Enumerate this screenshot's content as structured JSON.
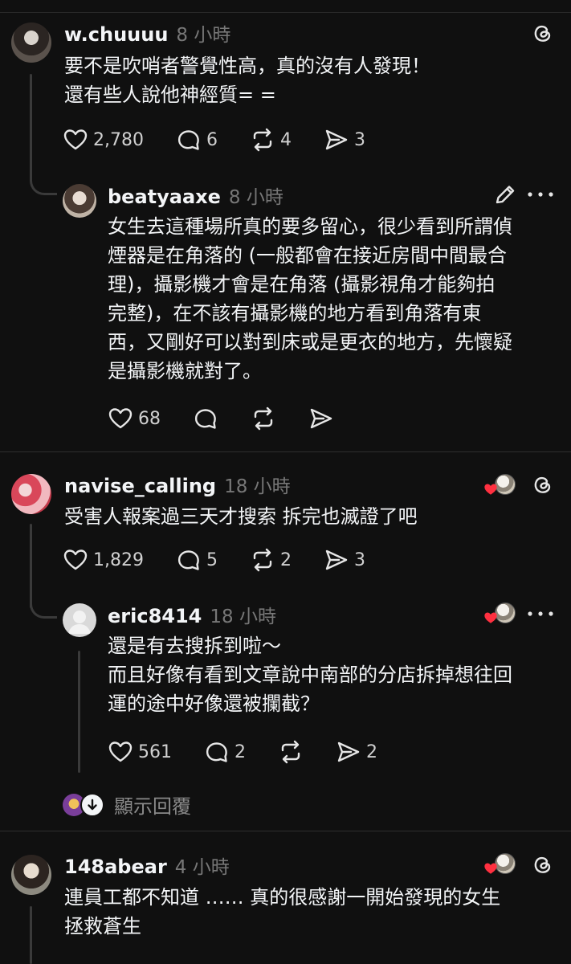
{
  "posts": [
    {
      "username": "w.chuuuu",
      "time": "8 小時",
      "text": "要不是吹哨者警覺性高，真的沒有人發現！\n還有些人說他神經質= =",
      "likes": "2,780",
      "comments": "6",
      "reposts": "4",
      "shares": "3"
    },
    {
      "username": "beatyaaxe",
      "time": "8 小時",
      "text": "女生去這種場所真的要多留心，很少看到所謂偵\n煙器是在角落的 (一般都會在接近房間中間最合\n理)，攝影機才會是在角落 (攝影視角才能夠拍\n完整)，在不該有攝影機的地方看到角落有東\n西，又剛好可以對到床或是更衣的地方，先懷疑\n是攝影機就對了。",
      "likes": "68"
    },
    {
      "username": "navise_calling",
      "time": "18 小時",
      "text": "受害人報案過三天才搜索 拆完也滅證了吧",
      "likes": "1,829",
      "comments": "5",
      "reposts": "2",
      "shares": "3"
    },
    {
      "username": "eric8414",
      "time": "18 小時",
      "text": "還是有去搜拆到啦～\n而且好像有看到文章說中南部的分店拆掉想往回\n運的途中好像還被攔截？",
      "likes": "561",
      "comments": "2",
      "shares": "2"
    },
    {
      "username": "148abear",
      "time": "4 小時",
      "text": "連員工都不知道 …… 真的很感謝一開始發現的女生\n拯救蒼生"
    }
  ],
  "show_replies_label": "顯示回覆",
  "icons": [
    "threads-icon",
    "heart-icon",
    "comment-icon",
    "repost-icon",
    "share-icon",
    "edit-icon",
    "more-icon",
    "down-arrow-icon"
  ],
  "colors": {
    "background": "#101010",
    "text": "#f3f5f7",
    "muted": "#777777",
    "like_red": "#ff3040"
  }
}
